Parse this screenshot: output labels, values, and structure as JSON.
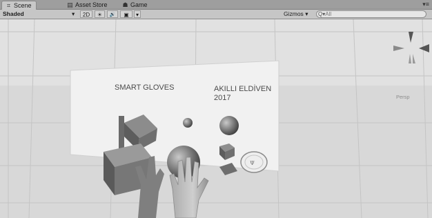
{
  "tabs": [
    {
      "label": "Scene",
      "icon": "scene-grid-icon",
      "active": true
    },
    {
      "label": "Asset Store",
      "icon": "asset-store-icon",
      "active": false
    },
    {
      "label": "Game",
      "icon": "game-controller-icon",
      "active": false
    }
  ],
  "window_menu_glyph": "▾≡",
  "toolbar": {
    "draw_mode": "Shaded",
    "draw_mode_arrow": "▾",
    "mode_2d": "2D",
    "lighting_glyph": "☀",
    "audio_glyph": "🔊",
    "effects_glyph": "▣",
    "effects_arrow": "▾",
    "gizmos_label": "Gizmos",
    "gizmos_arrow": "▾",
    "search_glyph": "Q▾",
    "search_placeholder": "All"
  },
  "scene": {
    "title_left": "SMART GLOVES",
    "title_right_line1": "AKILLI ELDİVEN",
    "title_right_line2": "2017",
    "gizmo_label": "Persp",
    "colors": {
      "sky": "#e3e3e3",
      "ground": "#dadada",
      "panel": "#f2f2f2",
      "object": "#7a7a7a",
      "object_dark": "#555555",
      "hand": "#9a9a9a"
    }
  }
}
